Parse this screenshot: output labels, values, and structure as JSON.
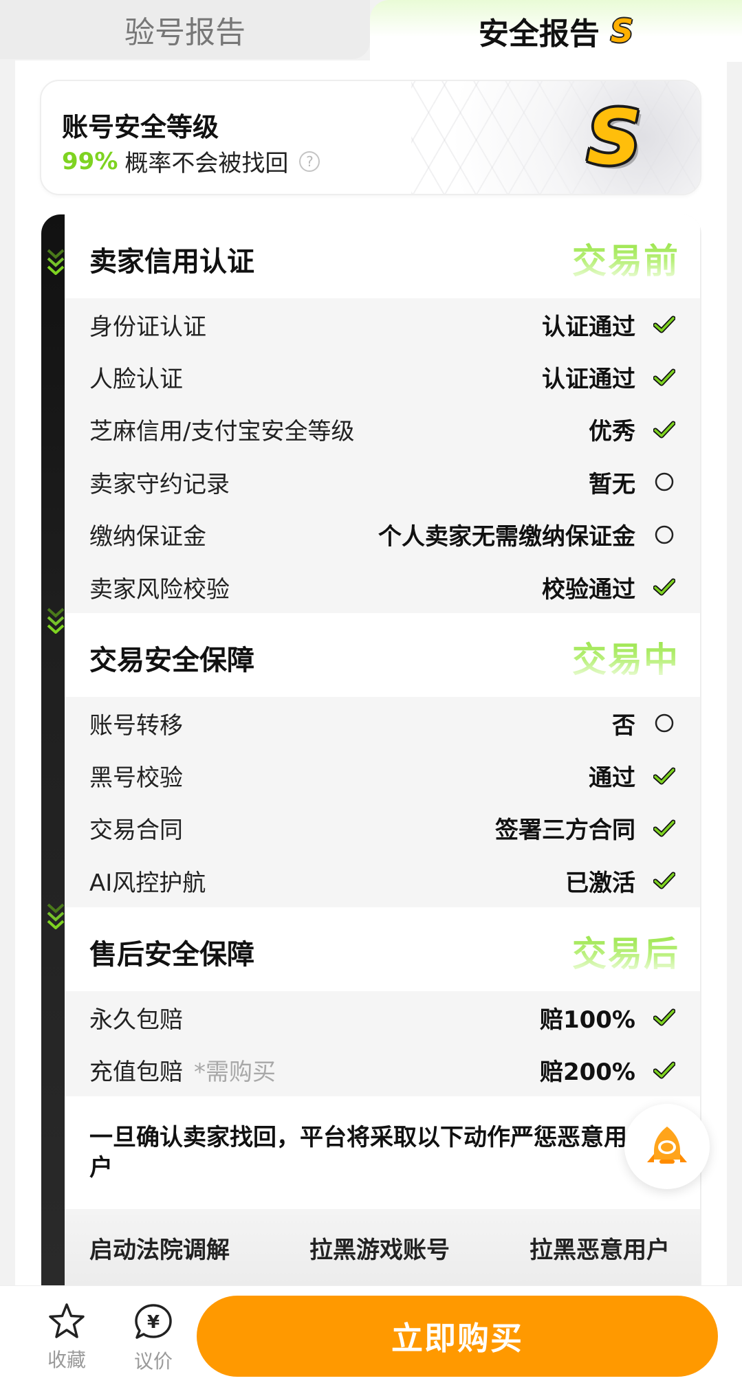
{
  "tabs": [
    {
      "label": "验号报告",
      "active": false
    },
    {
      "label": "安全报告",
      "active": true,
      "badge": "S"
    }
  ],
  "level": {
    "title": "账号安全等级",
    "percent": "99%",
    "description": "概率不会被找回",
    "help_icon": "?",
    "grade": "S"
  },
  "sections": [
    {
      "title": "卖家信用认证",
      "stage": "交易前",
      "rows": [
        {
          "label": "身份证认证",
          "value": "认证通过",
          "status": "check"
        },
        {
          "label": "人脸认证",
          "value": "认证通过",
          "status": "check"
        },
        {
          "label": "芝麻信用/支付宝安全等级",
          "value": "优秀",
          "status": "check"
        },
        {
          "label": "卖家守约记录",
          "value": "暂无",
          "status": "circle"
        },
        {
          "label": "缴纳保证金",
          "value": "个人卖家无需缴纳保证金",
          "status": "circle"
        },
        {
          "label": "卖家风险校验",
          "value": "校验通过",
          "status": "check"
        }
      ]
    },
    {
      "title": "交易安全保障",
      "stage": "交易中",
      "rows": [
        {
          "label": "账号转移",
          "value": "否",
          "status": "circle"
        },
        {
          "label": "黑号校验",
          "value": "通过",
          "status": "check"
        },
        {
          "label": "交易合同",
          "value": "签署三方合同",
          "status": "check"
        },
        {
          "label": "AI风控护航",
          "value": "已激活",
          "status": "check"
        }
      ]
    },
    {
      "title": "售后安全保障",
      "stage": "交易后",
      "rows": [
        {
          "label": "永久包赔",
          "value": "赔100%",
          "status": "check"
        },
        {
          "label": "充值包赔",
          "note": "*需购买",
          "value": "赔200%",
          "status": "check"
        }
      ]
    }
  ],
  "notice": "一旦确认卖家找回，平台将采取以下动作严惩恶意用户",
  "actions": [
    "启动法院调解",
    "拉黑游戏账号",
    "拉黑恶意用户"
  ],
  "bottom_bar": {
    "favorite_label": "收藏",
    "bargain_label": "议价",
    "bargain_icon_text": "¥",
    "buy_label": "立即购买"
  },
  "colors": {
    "accent_green": "#7ed321",
    "buy_orange": "#ff9900",
    "badge_gold": "#ffbe0b"
  },
  "icons": {
    "check": "check-icon",
    "circle": "empty-circle-icon",
    "favorite": "star-icon",
    "bargain": "yen-bubble-icon",
    "float": "rocket-mascot-icon"
  }
}
